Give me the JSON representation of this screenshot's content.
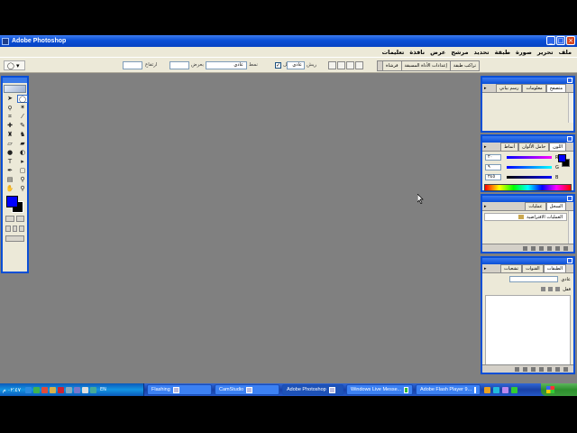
{
  "window": {
    "title": "Adobe Photoshop"
  },
  "menu": [
    "ملف",
    "تحرير",
    "صورة",
    "طبقة",
    "تحديد",
    "مرشح",
    "عرض",
    "نافذة",
    "تعليمات"
  ],
  "options": {
    "mode_value": "عادي",
    "mode_label": "نمط",
    "antialias_label": "مسقيل",
    "style_value": "عادي",
    "width_label": "بعرض",
    "height_label": "ارتفاع",
    "feather_label": "ريش"
  },
  "well_tabs": [
    "فرشاة",
    "إعدادات الأداة المسبقة",
    "تراكب طبقة"
  ],
  "palettes": {
    "navigator": {
      "tabs": [
        "متصفح",
        "معلومات",
        "رسم بياني"
      ]
    },
    "color": {
      "tabs": [
        "اللون",
        "حامل الألوان",
        "أنماط"
      ],
      "channels": [
        {
          "label": "R",
          "value": "٢٠"
        },
        {
          "label": "G",
          "value": "٩"
        },
        {
          "label": "B",
          "value": "٢٤٥"
        }
      ],
      "foreground": "#0000ff",
      "background": "#000000"
    },
    "history": {
      "tabs": [
        "السجل",
        "عمليات"
      ],
      "item": "العمليات الافتراضية"
    },
    "layers": {
      "tabs": [
        "الطبقات",
        "القنوات",
        "تشعبات"
      ],
      "blend_label": "عادي",
      "opacity_label": "قفل"
    }
  },
  "taskbar": {
    "clock": "٠٢:٤٧ م",
    "lang": "EN",
    "tasks": [
      {
        "label": "Flashing"
      },
      {
        "label": "CamStudio"
      },
      {
        "label": "Adobe Photoshop",
        "active": true
      },
      {
        "label": "Windows Live Messe..."
      },
      {
        "label": "Adobe Flash Player 9..."
      }
    ]
  },
  "tools": [
    "move-icon",
    "marquee-icon",
    "lasso-icon",
    "magic-wand-icon",
    "crop-icon",
    "slice-icon",
    "healing-icon",
    "brush-icon",
    "stamp-icon",
    "history-brush-icon",
    "eraser-icon",
    "gradient-icon",
    "blur-icon",
    "dodge-icon",
    "path-select-icon",
    "type-icon",
    "pen-icon",
    "shape-icon",
    "notes-icon",
    "eyedropper-icon",
    "hand-icon",
    "zoom-icon"
  ]
}
